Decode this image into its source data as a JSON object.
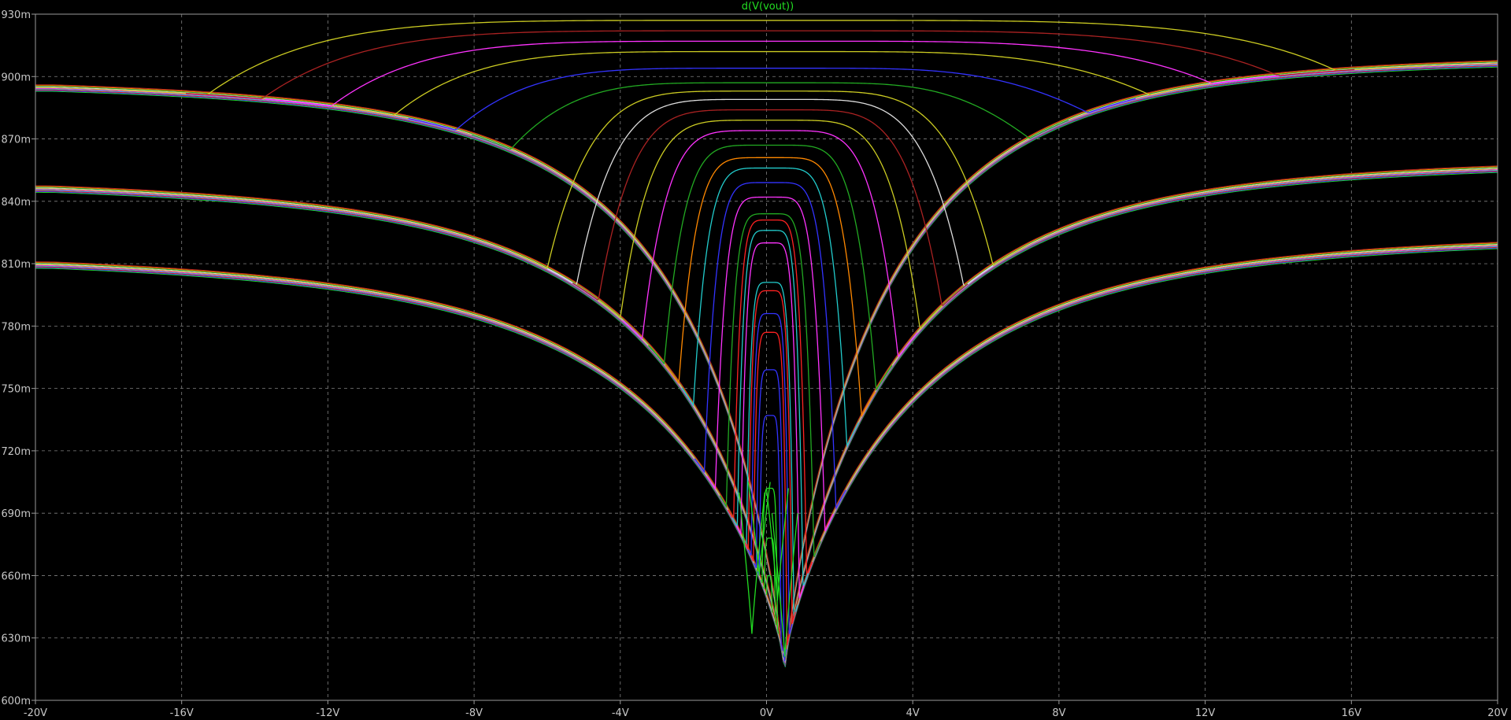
{
  "chart_data": {
    "type": "line",
    "title": "d(V(vout))",
    "title_color": "#22dd22",
    "background": "#000000",
    "frame_color": "#9a9a9a",
    "grid": true,
    "grid_color": "#808080",
    "grid_style": "dashed",
    "xlim": [
      -20,
      20
    ],
    "ylim": [
      600,
      930
    ],
    "x_ticks": [
      -20,
      -16,
      -12,
      -8,
      -4,
      0,
      4,
      8,
      12,
      16,
      20
    ],
    "x_tick_labels": [
      "-20V",
      "-16V",
      "-12V",
      "-8V",
      "-4V",
      "0V",
      "4V",
      "8V",
      "12V",
      "16V",
      "20V"
    ],
    "y_ticks": [
      930,
      900,
      870,
      840,
      810,
      780,
      750,
      720,
      690,
      660,
      630,
      600
    ],
    "y_tick_labels": [
      "930m",
      "900m",
      "870m",
      "840m",
      "810m",
      "780m",
      "750m",
      "720m",
      "690m",
      "660m",
      "630m",
      "600m"
    ],
    "palette": [
      "#22dd22",
      "#3333ff",
      "#ff2222",
      "#22cccc",
      "#ff33ff",
      "#cccc22",
      "#dddddd",
      "#22aa22",
      "#ff8800",
      "#aa2222"
    ],
    "families": [
      {
        "left_level": 896,
        "right_level": 908,
        "hinge_left": -7.6,
        "hinge_right": 7.6,
        "center": 0.5,
        "bottom": 618,
        "slope": 2.8
      },
      {
        "left_level": 848,
        "right_level": 858,
        "hinge_left": -6.1,
        "hinge_right": 7.1,
        "center": 0.5,
        "bottom": 620,
        "slope": 3.2
      },
      {
        "left_level": 812,
        "right_level": 822,
        "hinge_left": -4.9,
        "hinge_right": 5.9,
        "center": 0.5,
        "bottom": 624,
        "slope": 3.6
      }
    ],
    "series": [
      {
        "plateau": 927,
        "x_left": -15.3,
        "x_right": 15.6,
        "color": "#cccc22"
      },
      {
        "plateau": 922,
        "x_left": -13.8,
        "x_right": 14.0,
        "color": "#aa2222"
      },
      {
        "plateau": 917,
        "x_left": -11.9,
        "x_right": 12.2,
        "color": "#ff33ff"
      },
      {
        "plateau": 912,
        "x_left": -10.2,
        "x_right": 10.5,
        "color": "#cccc22"
      },
      {
        "plateau": 904,
        "x_left": -8.5,
        "x_right": 8.8,
        "color": "#3333ff"
      },
      {
        "plateau": 897,
        "x_left": -7.0,
        "x_right": 7.2,
        "color": "#22aa22"
      },
      {
        "plateau": 893,
        "x_left": -6.0,
        "x_right": 6.2,
        "color": "#cccc22"
      },
      {
        "plateau": 889,
        "x_left": -5.2,
        "x_right": 5.4,
        "color": "#dddddd"
      },
      {
        "plateau": 884,
        "x_left": -4.6,
        "x_right": 4.8,
        "color": "#aa2222"
      },
      {
        "plateau": 879,
        "x_left": -4.0,
        "x_right": 4.2,
        "color": "#cccc22"
      },
      {
        "plateau": 874,
        "x_left": -3.4,
        "x_right": 3.6,
        "color": "#ff33ff"
      },
      {
        "plateau": 867,
        "x_left": -2.8,
        "x_right": 3.0,
        "color": "#22aa22"
      },
      {
        "plateau": 861,
        "x_left": -2.4,
        "x_right": 2.6,
        "color": "#ff8800"
      },
      {
        "plateau": 856,
        "x_left": -2.0,
        "x_right": 2.2,
        "color": "#22cccc"
      },
      {
        "plateau": 849,
        "x_left": -1.7,
        "x_right": 1.9,
        "color": "#3333ff"
      },
      {
        "plateau": 842,
        "x_left": -1.4,
        "x_right": 1.6,
        "color": "#ff33ff"
      },
      {
        "plateau": 834,
        "x_left": -1.1,
        "x_right": 1.3,
        "color": "#22aa22"
      },
      {
        "plateau": 831,
        "x_left": -0.9,
        "x_right": 1.1,
        "color": "#ff2222"
      },
      {
        "plateau": 826,
        "x_left": -0.8,
        "x_right": 1.0,
        "color": "#22cccc"
      },
      {
        "plateau": 820,
        "x_left": -0.7,
        "x_right": 0.9,
        "color": "#ff33ff"
      },
      {
        "plateau": 801,
        "x_left": -0.55,
        "x_right": 0.75,
        "color": "#22cccc"
      },
      {
        "plateau": 797,
        "x_left": -0.5,
        "x_right": 0.7,
        "color": "#ff2222"
      },
      {
        "plateau": 786,
        "x_left": -0.42,
        "x_right": 0.62,
        "color": "#3333ff"
      },
      {
        "plateau": 777,
        "x_left": -0.36,
        "x_right": 0.56,
        "color": "#ff2222"
      },
      {
        "plateau": 759,
        "x_left": -0.28,
        "x_right": 0.48,
        "color": "#3333ff"
      },
      {
        "plateau": 737,
        "x_left": -0.2,
        "x_right": 0.4,
        "color": "#3333ff"
      },
      {
        "plateau": 702,
        "x_left": -0.12,
        "x_right": 0.3,
        "color": "#22dd22"
      },
      {
        "plateau": 678,
        "x_left": -0.06,
        "x_right": 0.24,
        "color": "#22dd22"
      },
      {
        "plateau": 660,
        "x_left": 0.0,
        "x_right": 0.15,
        "color": "#22dd22"
      }
    ]
  }
}
